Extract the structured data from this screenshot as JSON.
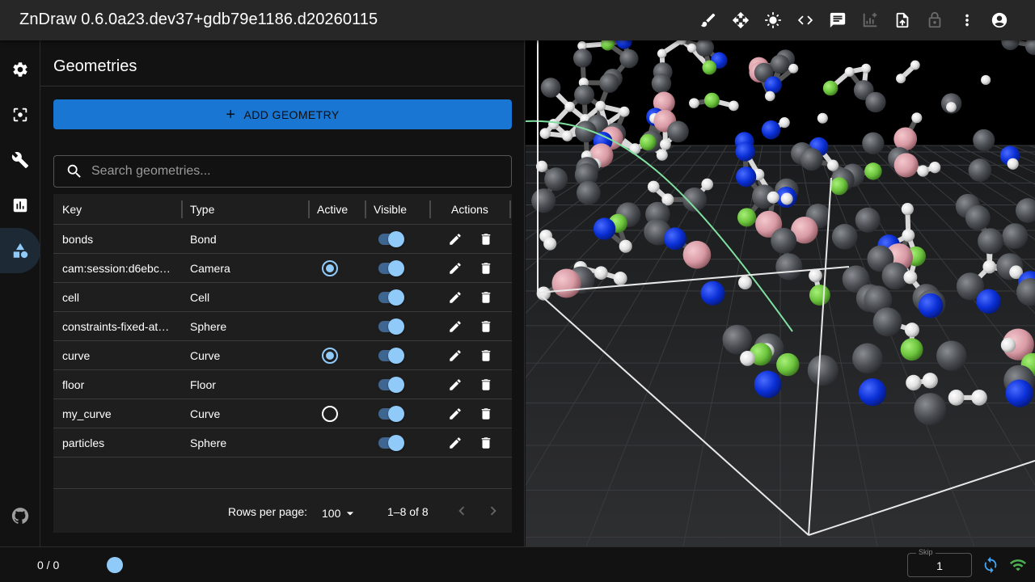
{
  "app": {
    "title": "ZnDraw 0.6.0a23.dev37+gdb79e1186.d20260115"
  },
  "toolbar": {
    "icons": [
      "brush-icon",
      "move-icon",
      "brightness-icon",
      "code-icon",
      "chat-icon",
      "analytics-icon",
      "upload-icon",
      "lock-icon",
      "more-vert-icon",
      "account-icon"
    ]
  },
  "sidebar": {
    "items": [
      "settings",
      "selection",
      "modifiers",
      "analysis",
      "geometries"
    ],
    "active": "geometries"
  },
  "panel": {
    "title": "Geometries",
    "add_label": "ADD GEOMETRY",
    "search_placeholder": "Search geometries...",
    "columns": {
      "key": "Key",
      "type": "Type",
      "active": "Active",
      "visible": "Visible",
      "actions": "Actions"
    },
    "rows": [
      {
        "key": "bonds",
        "type": "Bond",
        "active": "none",
        "visible": true
      },
      {
        "key": "cam:session:d6ebc…",
        "type": "Camera",
        "active": "checked",
        "visible": true
      },
      {
        "key": "cell",
        "type": "Cell",
        "active": "none",
        "visible": true
      },
      {
        "key": "constraints-fixed-at…",
        "type": "Sphere",
        "active": "none",
        "visible": true
      },
      {
        "key": "curve",
        "type": "Curve",
        "active": "checked",
        "visible": true
      },
      {
        "key": "floor",
        "type": "Floor",
        "active": "none",
        "visible": true
      },
      {
        "key": "my_curve",
        "type": "Curve",
        "active": "unchecked",
        "visible": true
      },
      {
        "key": "particles",
        "type": "Sphere",
        "active": "none",
        "visible": true
      }
    ],
    "footer": {
      "rows_per_page_label": "Rows per page:",
      "rows_per_page_value": "100",
      "range": "1–8 of 8"
    }
  },
  "bottombar": {
    "frame": "0 / 0",
    "skip_label": "Skip",
    "skip_value": "1"
  },
  "colors": {
    "accent": "#90caf9",
    "primary_button": "#1976d2",
    "atom_carbon": "#4a4d52",
    "atom_nitrogen": "#0a2fd6",
    "atom_fluorine": "#6cc43c",
    "atom_boron": "#d89aa4",
    "atom_hydrogen": "#e8e8e8",
    "curve": "#7fe0a0"
  }
}
